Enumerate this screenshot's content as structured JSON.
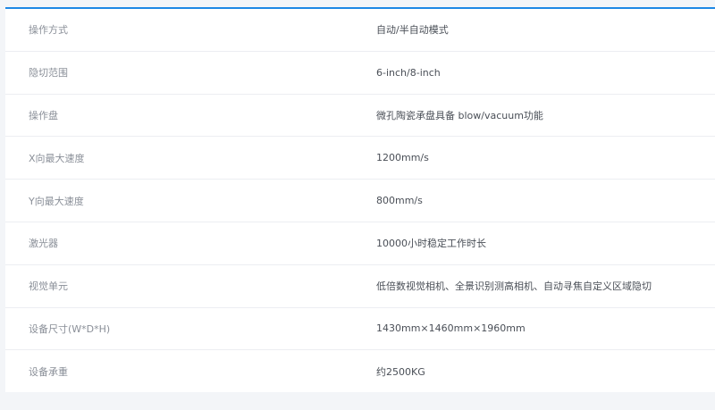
{
  "specs": [
    {
      "label": "操作方式",
      "value": "自动/半自动模式"
    },
    {
      "label": "隐切范围",
      "value": "6-inch/8-inch"
    },
    {
      "label": "操作盘",
      "value": "微孔陶瓷承盘具备 blow/vacuum功能"
    },
    {
      "label": "X向最大速度",
      "value": "1200mm/s"
    },
    {
      "label": "Y向最大速度",
      "value": "800mm/s"
    },
    {
      "label": "激光器",
      "value": "10000小时稳定工作时长"
    },
    {
      "label": "视觉单元",
      "value": "低倍数视觉相机、全景识别测高相机、自动寻焦自定义区域隐切"
    },
    {
      "label": "设备尺寸(W*D*H)",
      "value": "1430mm×1460mm×1960mm"
    },
    {
      "label": "设备承重",
      "value": "约2500KG"
    }
  ],
  "colors": {
    "accent": "#1e88e5",
    "background": "#f3f5f8",
    "label_text": "#8a8f98",
    "value_text": "#4a4f57"
  }
}
